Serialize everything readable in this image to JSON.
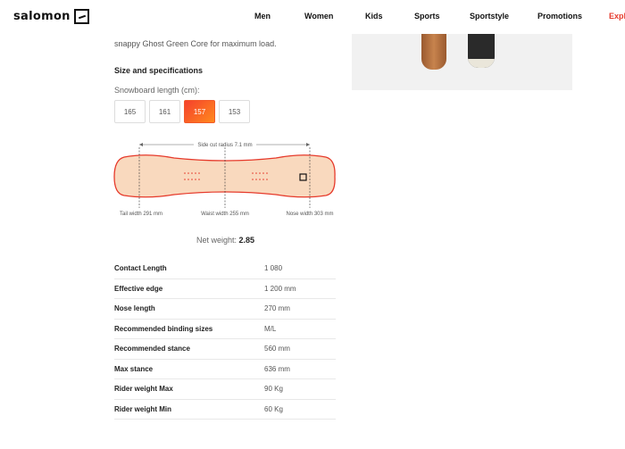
{
  "header": {
    "logo_text": "salomon",
    "nav": [
      "Men",
      "Women",
      "Kids",
      "Sports",
      "Sportstyle",
      "Promotions",
      "Explo"
    ]
  },
  "product": {
    "intro_tail": "snappy Ghost Green Core for maximum load.",
    "section_title": "Size and specifications",
    "length_label": "Snowboard length (cm):",
    "sizes": [
      "165",
      "161",
      "157",
      "153"
    ],
    "selected_size": "157",
    "diagram": {
      "side_cut": "Side cut radius 7.1 mm",
      "tail_width": "Tail width 291 mm",
      "waist_width": "Waist width 255 mm",
      "nose_width": "Nose width 303 mm"
    },
    "net_weight_label": "Net weight:",
    "net_weight_value": "2.85",
    "specs": [
      {
        "label": "Contact Length",
        "value": "1 080"
      },
      {
        "label": "Effective edge",
        "value": "1 200 mm"
      },
      {
        "label": "Nose length",
        "value": "270 mm"
      },
      {
        "label": "Recommended binding sizes",
        "value": "M/L"
      },
      {
        "label": "Recommended stance",
        "value": "560 mm"
      },
      {
        "label": "Max stance",
        "value": "636 mm"
      },
      {
        "label": "Rider weight Max",
        "value": "90 Kg"
      },
      {
        "label": "Rider weight Min",
        "value": "60 Kg"
      }
    ]
  },
  "colors": {
    "accent": "#f5402c",
    "board_fill": "#f9d9be",
    "board_outline": "#e63a2b"
  }
}
